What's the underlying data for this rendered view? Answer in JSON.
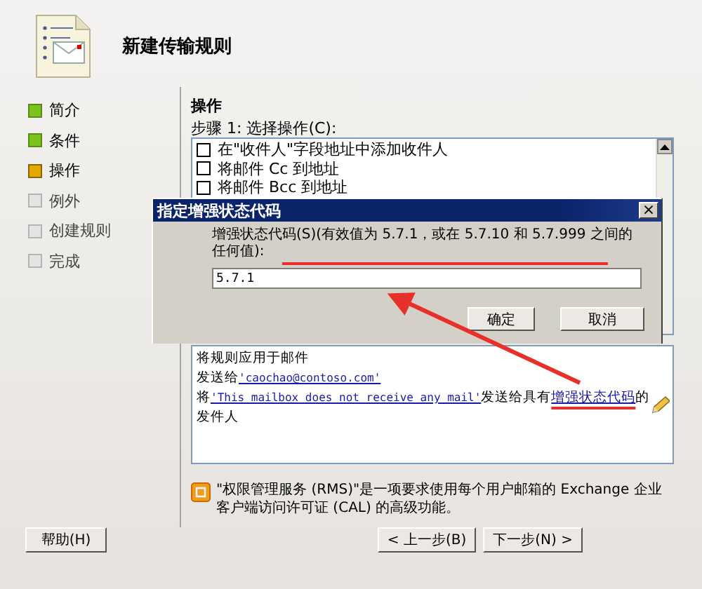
{
  "wizard": {
    "title": "新建传输规则"
  },
  "nav": [
    {
      "label": "简介",
      "kind": "done"
    },
    {
      "label": "条件",
      "kind": "done"
    },
    {
      "label": "操作",
      "kind": "current"
    },
    {
      "label": "例外",
      "kind": "pending"
    },
    {
      "label": "创建规则",
      "kind": "pending"
    },
    {
      "label": "完成",
      "kind": "pending"
    }
  ],
  "page": {
    "heading": "操作",
    "step1_label": "步骤 1: 选择操作(C):",
    "actions": [
      {
        "label": "在\"收件人\"字段地址中添加收件人",
        "checked": false
      },
      {
        "label": "将邮件 Cc 到地址",
        "checked": false
      },
      {
        "label": "将邮件 Bcc 到地址",
        "checked": false
      }
    ],
    "rule_lines": [
      [
        {
          "text": "将规则应用于邮件",
          "link": false
        }
      ],
      [
        {
          "text": "发送给",
          "link": false
        },
        {
          "text": "'caochao@contoso.com'",
          "link": true
        }
      ],
      [
        {
          "text": "将",
          "link": false
        },
        {
          "text": "'This mailbox does not receive any mail'",
          "link": true
        },
        {
          "text": "发送给具有",
          "link": false
        },
        {
          "text": "增强状态代码",
          "link": true
        },
        {
          "text": "的",
          "link": false
        }
      ],
      [
        {
          "text": "发件人",
          "link": false
        }
      ]
    ],
    "note": "\"权限管理服务 (RMS)\"是一项要求使用每个用户邮箱的 Exchange 企业客户端访问许可证 (CAL) 的高级功能。"
  },
  "dialog": {
    "title": "指定增强状态代码",
    "close": "×",
    "label": "增强状态代码(S)(有效值为 5.7.1，或在 5.7.10 和 5.7.999 之间的任何值):",
    "value": "5.7.1",
    "buttons": [
      "确定",
      "取消"
    ]
  },
  "footer": {
    "help": "帮助(H)",
    "back": "< 上一步(B)",
    "next": "下一步(N) >"
  }
}
